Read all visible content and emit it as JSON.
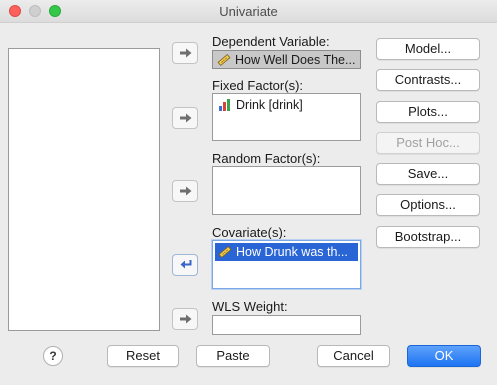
{
  "window": {
    "title": "Univariate"
  },
  "colors": {
    "selection": "#2a65d6",
    "primary_button": "#1d73f2",
    "close": "#fc605c",
    "maximize": "#34c84a"
  },
  "targets": {
    "dependent": {
      "label": "Dependent Variable:",
      "value": "How Well Does The..."
    },
    "fixed": {
      "label": "Fixed Factor(s):",
      "items": [
        {
          "text": "Drink [drink]",
          "icon": "nominal-bar-icon"
        }
      ]
    },
    "random": {
      "label": "Random Factor(s):"
    },
    "covariate": {
      "label": "Covariate(s):",
      "items": [
        {
          "text": "How Drunk was th...",
          "icon": "scale-ruler-icon",
          "selected": true
        }
      ]
    },
    "wls": {
      "label": "WLS Weight:"
    }
  },
  "side_buttons": {
    "model": "Model...",
    "contrasts": "Contrasts...",
    "plots": "Plots...",
    "posthoc": "Post Hoc...",
    "save": "Save...",
    "options": "Options...",
    "bootstrap": "Bootstrap..."
  },
  "footer": {
    "help": "?",
    "reset": "Reset",
    "paste": "Paste",
    "cancel": "Cancel",
    "ok": "OK"
  }
}
